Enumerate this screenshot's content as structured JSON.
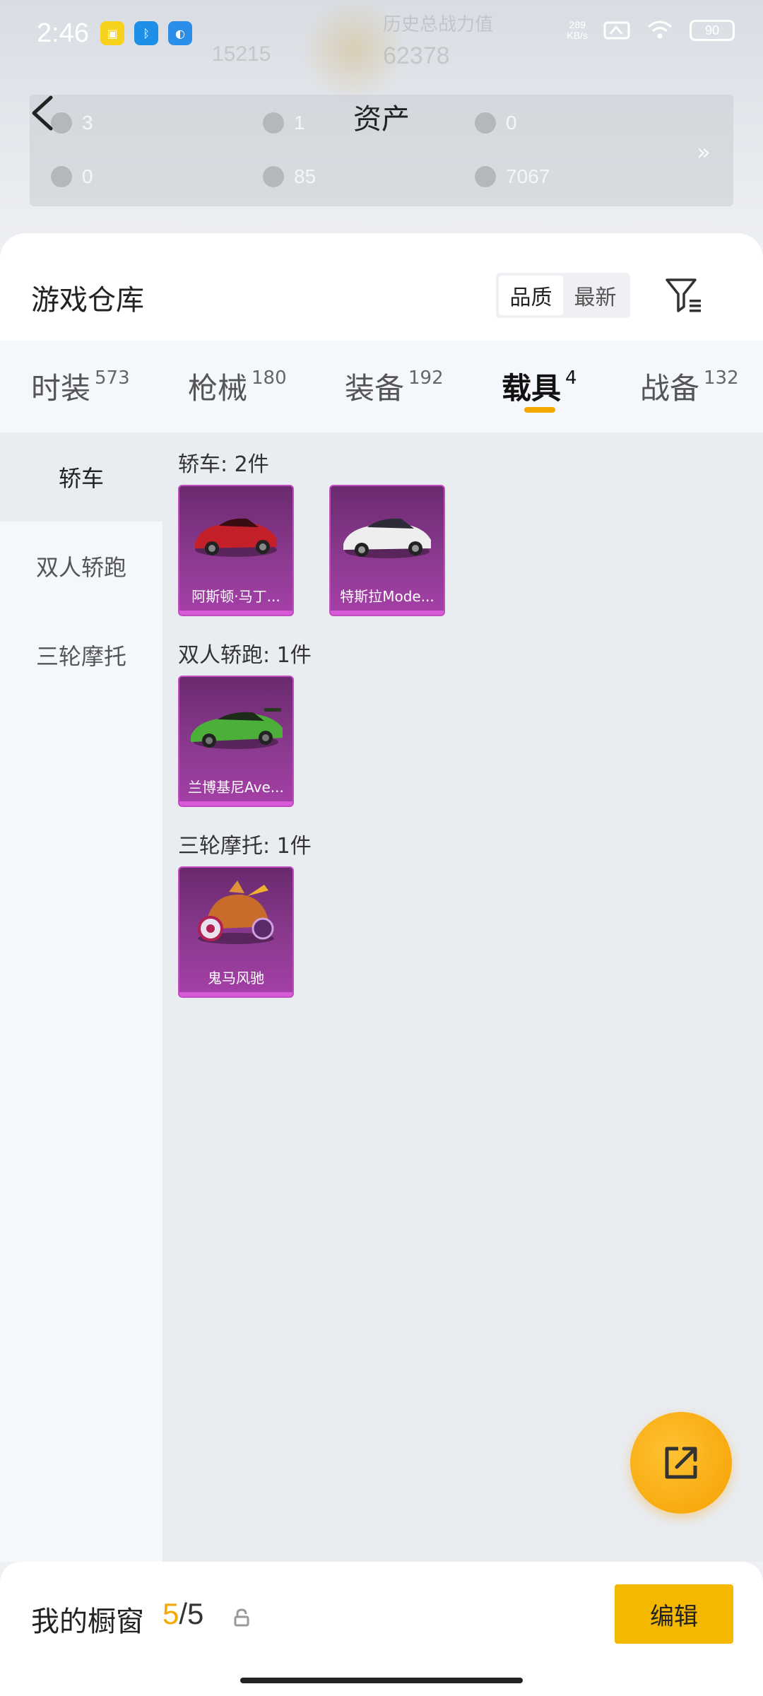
{
  "status_bar": {
    "time": "2:46",
    "net_speed_value": "289",
    "net_speed_unit": "KB/s",
    "battery": "90"
  },
  "header": {
    "bg_label": "历史总战力值",
    "bg_value": "62378",
    "bg_value2": "15215",
    "title": "资产",
    "assets": [
      {
        "value": "3"
      },
      {
        "value": "1"
      },
      {
        "value": "0"
      },
      {
        "value": "0"
      },
      {
        "value": "85"
      },
      {
        "value": "7067"
      }
    ],
    "more": "»"
  },
  "warehouse": {
    "title": "游戏仓库",
    "sort_options": [
      "品质",
      "最新"
    ],
    "sort_active": "品质"
  },
  "tabs": [
    {
      "label": "时装",
      "count": "573"
    },
    {
      "label": "枪械",
      "count": "180"
    },
    {
      "label": "装备",
      "count": "192"
    },
    {
      "label": "载具",
      "count": "4"
    },
    {
      "label": "战备",
      "count": "132"
    }
  ],
  "active_tab": "载具",
  "side_nav": [
    "轿车",
    "双人轿跑",
    "三轮摩托"
  ],
  "active_side": "轿车",
  "groups": [
    {
      "title": "轿车: 2件",
      "items": [
        "阿斯顿·马丁...",
        "特斯拉Mode..."
      ]
    },
    {
      "title": "双人轿跑: 1件",
      "items": [
        "兰博基尼Ave..."
      ]
    },
    {
      "title": "三轮摩托: 1件",
      "items": [
        "鬼马风驰"
      ]
    }
  ],
  "colors": {
    "accent": "#f5a800",
    "card_purple": "#8b3a8f"
  },
  "showcase": {
    "title": "我的橱窗",
    "current": "5",
    "sep": "/",
    "total": "5",
    "edit_label": "编辑"
  }
}
